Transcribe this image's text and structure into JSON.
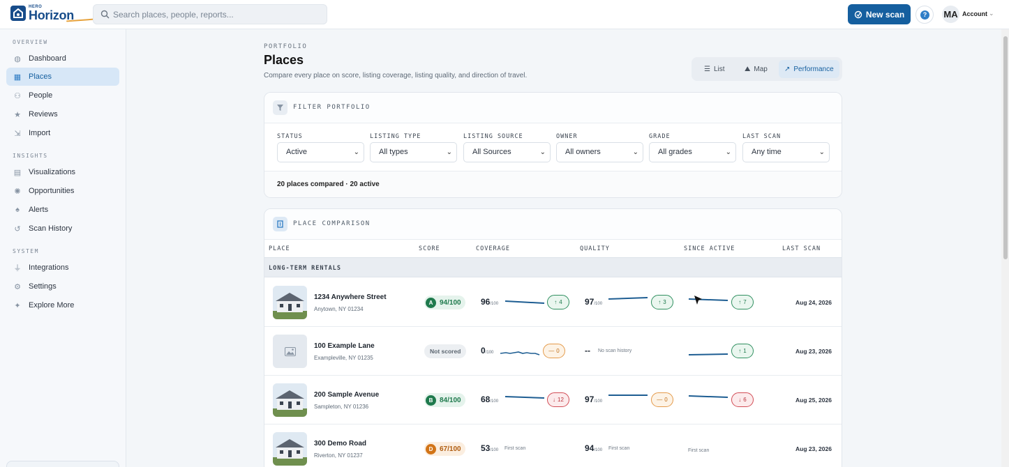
{
  "brand": {
    "eyebrow": "HERO",
    "name": "Horizon"
  },
  "search": {
    "placeholder": "Search places, people, reports..."
  },
  "header": {
    "new_scan": "New scan",
    "help": "?",
    "avatar": "MA",
    "account": "Account"
  },
  "sidebar": {
    "sections": [
      {
        "title": "OVERVIEW",
        "items": [
          {
            "label": "Dashboard",
            "icon": "dashboard-icon"
          },
          {
            "label": "Places",
            "icon": "building-icon",
            "active": true
          },
          {
            "label": "People",
            "icon": "people-icon"
          },
          {
            "label": "Reviews",
            "icon": "star-icon"
          },
          {
            "label": "Import",
            "icon": "import-icon"
          }
        ]
      },
      {
        "title": "INSIGHTS",
        "items": [
          {
            "label": "Visualizations",
            "icon": "chart-icon"
          },
          {
            "label": "Opportunities",
            "icon": "lightbulb-icon"
          },
          {
            "label": "Alerts",
            "icon": "bell-icon"
          },
          {
            "label": "Scan History",
            "icon": "history-icon"
          }
        ]
      },
      {
        "title": "SYSTEM",
        "items": [
          {
            "label": "Integrations",
            "icon": "plug-icon"
          },
          {
            "label": "Settings",
            "icon": "gear-icon"
          },
          {
            "label": "Explore More",
            "icon": "sparkle-icon"
          }
        ]
      }
    ]
  },
  "page": {
    "eyebrow": "PORTFOLIO",
    "title": "Places",
    "subtitle": "Compare every place on score, listing coverage, listing quality, and direction of travel.",
    "views": [
      {
        "label": "List",
        "icon": "list-icon"
      },
      {
        "label": "Map",
        "icon": "map-icon"
      },
      {
        "label": "Performance",
        "icon": "trend-icon",
        "active": true
      }
    ]
  },
  "filters": {
    "title": "FILTER PORTFOLIO",
    "fields": [
      {
        "label": "STATUS",
        "value": "Active"
      },
      {
        "label": "LISTING TYPE",
        "value": "All types"
      },
      {
        "label": "LISTING SOURCE",
        "value": "All Sources"
      },
      {
        "label": "OWNER",
        "value": "All owners"
      },
      {
        "label": "GRADE",
        "value": "All grades"
      },
      {
        "label": "LAST SCAN",
        "value": "Any time"
      }
    ],
    "summary": "20 places compared · 20 active"
  },
  "comparison": {
    "title": "PLACE COMPARISON",
    "columns": [
      "PLACE",
      "SCORE",
      "COVERAGE",
      "QUALITY",
      "SINCE ACTIVE",
      "LAST SCAN"
    ],
    "group": "LONG-TERM RENTALS",
    "rows": [
      {
        "name": "1234 Anywhere Street",
        "address": "Anytown, NY 01234",
        "grade": "A",
        "score": "94/100",
        "coverage": "96",
        "coverage_delta": "4",
        "quality": "97",
        "quality_delta": "3",
        "since_delta": "7",
        "last_scan": "Aug 24, 2026"
      },
      {
        "name": "100 Example Lane",
        "address": "Exampleville, NY 01235",
        "score": "Not scored",
        "coverage": "0",
        "coverage_delta": "0",
        "quality": "--",
        "quality_note": "No scan history",
        "since_delta": "1",
        "last_scan": "Aug 23, 2026"
      },
      {
        "name": "200 Sample Avenue",
        "address": "Sampleton, NY 01236",
        "grade": "B",
        "score": "84/100",
        "coverage": "68",
        "coverage_delta": "12",
        "quality": "97",
        "quality_delta": "0",
        "since_delta": "6",
        "last_scan": "Aug 25, 2026"
      },
      {
        "name": "300 Demo Road",
        "address": "Riverton, NY 01237",
        "grade": "D",
        "score": "67/100",
        "coverage": "53",
        "coverage_note": "First scan",
        "quality": "94",
        "quality_note": "First scan",
        "since_note": "First scan",
        "last_scan": "Aug 23, 2026"
      }
    ],
    "unit": "/100",
    "up_arrow": "↑",
    "down_arrow": "↓",
    "flat_mark": "—"
  },
  "colors": {
    "accent": "#155f9f",
    "active_nav": "#d7e7f7",
    "grade_good": "#1f7a4d",
    "grade_d": "#d27417"
  }
}
